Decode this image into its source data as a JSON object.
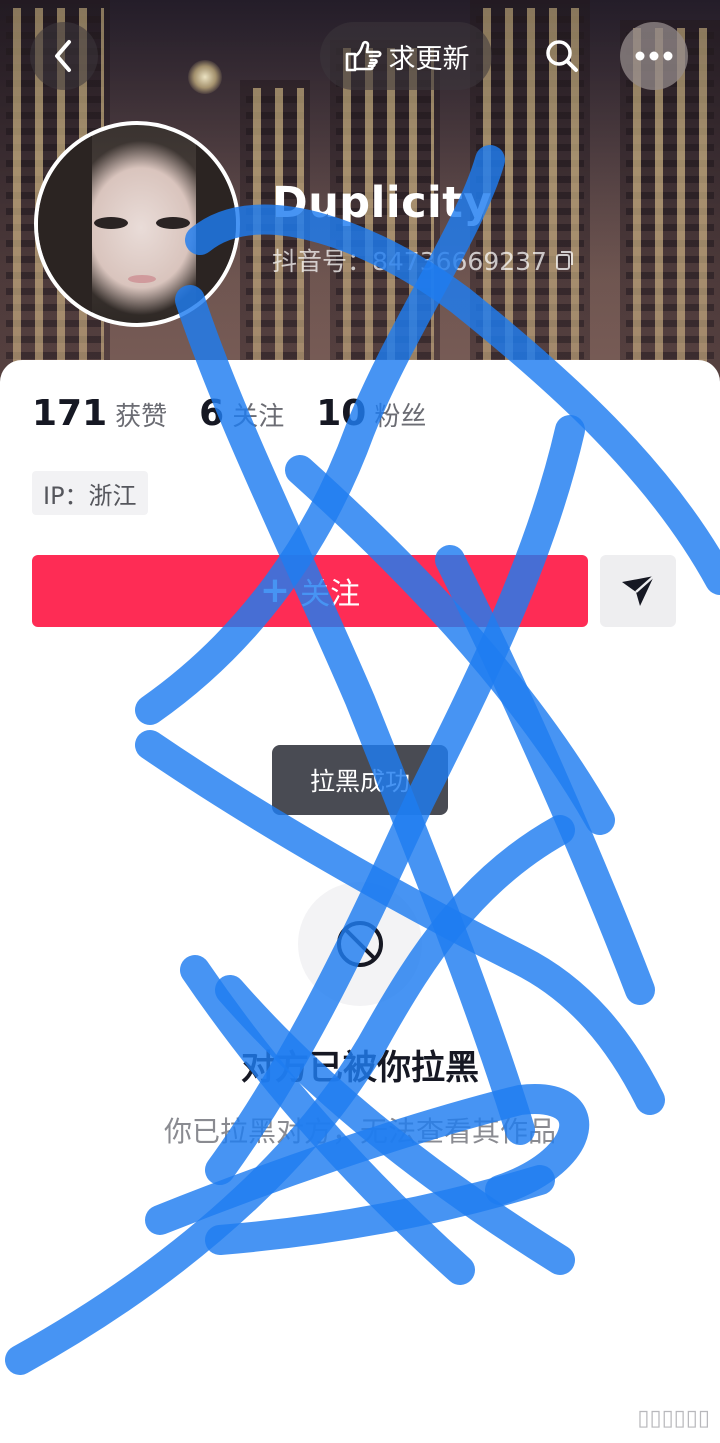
{
  "header": {
    "back_icon": "chevron-left-icon",
    "update_label": "求更新",
    "update_icon": "pointing-hand-icon",
    "search_icon": "search-icon",
    "more_icon": "more-dots-icon"
  },
  "profile": {
    "username": "Duplicity",
    "douyin_id": "抖音号：84736669237",
    "copy_icon": "copy-icon"
  },
  "stats": [
    {
      "value": "171",
      "label": "获赞"
    },
    {
      "value": "6",
      "label": "关注"
    },
    {
      "value": "10",
      "label": "粉丝"
    }
  ],
  "ip_location": "IP：浙江",
  "actions": {
    "follow_label": "关注",
    "follow_icon": "plus-icon",
    "message_icon": "send-icon"
  },
  "toast": "拉黑成功",
  "blocked": {
    "icon": "block-icon",
    "title": "对方已被你拉黑",
    "description": "你已拉黑对方，无法查看其作品"
  },
  "colors": {
    "follow_button": "#fe2c55",
    "scribble": "#1e7cf0"
  }
}
